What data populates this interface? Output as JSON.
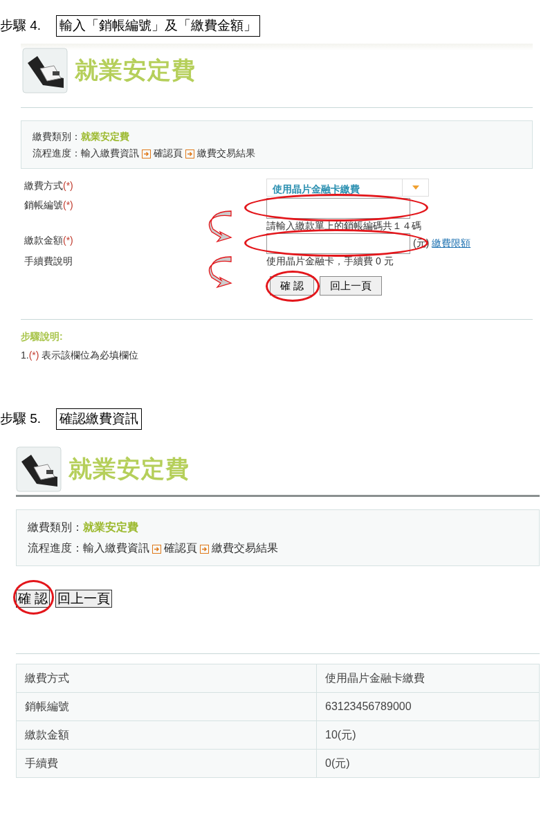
{
  "step4": {
    "number": "步驟 4.",
    "title": "輸入「銷帳編號」及「繳費金額」",
    "page": {
      "heading": "就業安定費",
      "info": {
        "category_label": "繳費類別：",
        "category_value": "就業安定費",
        "progress_label": "流程進度：",
        "progress_steps": [
          "輸入繳費資訊",
          "確認頁",
          "繳費交易結果"
        ]
      },
      "form": [
        {
          "kind": "select",
          "label": "繳費方式",
          "mark": "(*)",
          "value": "使用晶片金融卡繳費"
        },
        {
          "kind": "input",
          "label": "銷帳編號",
          "mark": "(*)",
          "highlighted": true,
          "arrow": false,
          "hint": "請輸入繳款單上的銷帳編碼共１４碼"
        },
        {
          "kind": "input",
          "label": "繳款金額",
          "mark": "(*)",
          "highlighted": true,
          "arrow": true,
          "unit": "(元)",
          "link": "繳費限額"
        },
        {
          "kind": "text",
          "label": "手續費說明",
          "value": "使用晶片金融卡，手續費 0 元"
        }
      ],
      "buttons": [
        {
          "label": "確 認",
          "highlighted": true,
          "arrow": true
        },
        {
          "label": "回上一頁",
          "highlighted": false,
          "arrow": false
        }
      ],
      "notes_title": "步驟說明:",
      "notes": [
        {
          "prefix": "1.",
          "mark": "(*)",
          "text": "表示該欄位為必填欄位"
        }
      ]
    }
  },
  "step5": {
    "number": "步驟 5.",
    "title": "確認繳費資訊",
    "page": {
      "heading": "就業安定費",
      "info": {
        "category_label": "繳費類別：",
        "category_value": "就業安定費",
        "progress_label": "流程進度：",
        "progress_steps": [
          "輸入繳費資訊",
          "確認頁",
          "繳費交易結果"
        ]
      },
      "buttons": [
        {
          "label": "確 認",
          "highlighted": true
        },
        {
          "label": "回上一頁",
          "highlighted": false
        }
      ],
      "table": [
        {
          "label": "繳費方式",
          "value": "使用晶片金融卡繳費"
        },
        {
          "label": "銷帳編號",
          "value": "63123456789000"
        },
        {
          "label": "繳款金額",
          "value": "10(元)"
        },
        {
          "label": "手續費",
          "value": "0(元)"
        }
      ]
    }
  }
}
